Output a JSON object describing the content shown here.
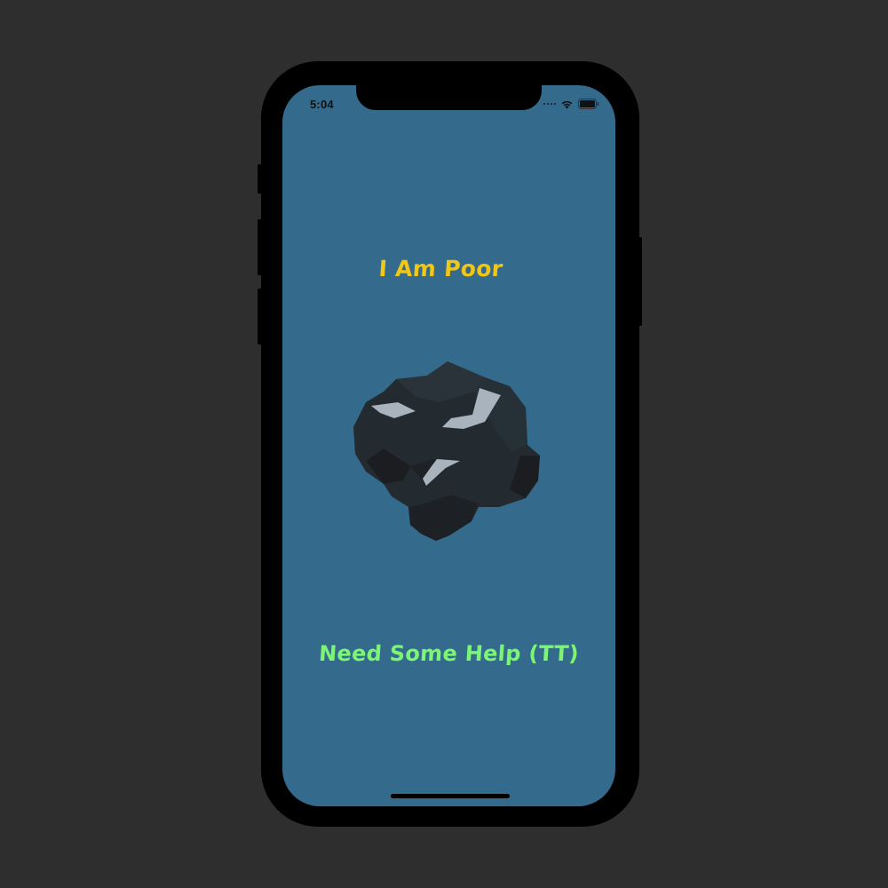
{
  "status_bar": {
    "time": "5:04",
    "icons": [
      "cellular-dots-icon",
      "wifi-icon",
      "battery-icon"
    ]
  },
  "main": {
    "title": "I Am Poor",
    "image": "coal-rock-image",
    "help_text": "Need Some Help (TT)"
  },
  "colors": {
    "background": "#346a8b",
    "title": "#f2c614",
    "help_text": "#7cf476",
    "coal_dark": "#232b31",
    "coal_highlight": "#a9b3bd"
  }
}
